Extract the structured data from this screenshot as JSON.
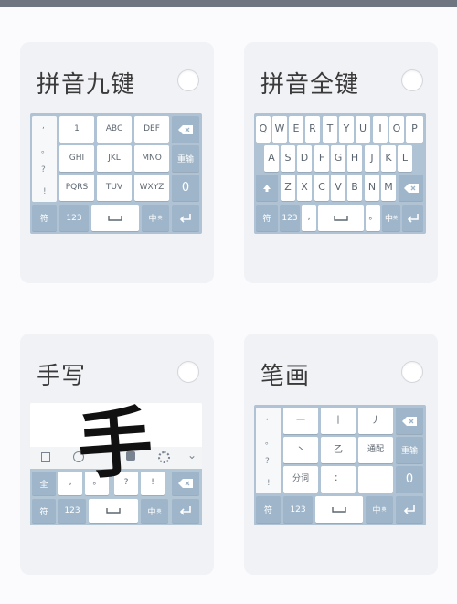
{
  "accent_color": "#afc3d4",
  "cards": {
    "pinyin9": {
      "title": "拼音九键",
      "keys": [
        "1",
        "ABC",
        "DEF",
        "GHI",
        "JKL",
        "MNO",
        "PQRS",
        "TUV",
        "WXYZ"
      ],
      "sym_strip": [
        ",",
        "。",
        "?",
        "!"
      ],
      "backspace_icon": "backspace-icon",
      "re_input": "重输",
      "zero": "0",
      "bottom": {
        "symbol": "符",
        "num": "123",
        "space_icon": "space-icon",
        "lang": "中",
        "lang_sub": "英",
        "enter_icon": "enter-icon"
      }
    },
    "pinyin26": {
      "title": "拼音全键",
      "row1": [
        "Q",
        "W",
        "E",
        "R",
        "T",
        "Y",
        "U",
        "I",
        "O",
        "P"
      ],
      "row2": [
        "A",
        "S",
        "D",
        "F",
        "G",
        "H",
        "J",
        "K",
        "L"
      ],
      "row3": [
        "Z",
        "X",
        "C",
        "V",
        "B",
        "N",
        "M"
      ],
      "shift_icon": "shift-icon",
      "backspace_icon": "backspace-icon",
      "bottom": {
        "symbol": "符",
        "num": "123",
        "comma": ",",
        "space_icon": "space-icon",
        "period": "。",
        "lang": "中",
        "lang_sub": "英",
        "enter_icon": "enter-icon"
      }
    },
    "handwrite": {
      "title": "手写",
      "sample_char": "手",
      "toolbar_icons": [
        "grid-icon",
        "emoji-icon",
        "handwrite-icon",
        "gear-icon",
        "chevron-down-icon"
      ],
      "quickbar": [
        "全",
        ",",
        "。",
        "?",
        "!"
      ],
      "backspace_icon": "backspace-icon",
      "bottom": {
        "symbol": "符",
        "num": "123",
        "space_icon": "space-icon",
        "lang": "中",
        "lang_sub": "英",
        "enter_icon": "enter-icon"
      }
    },
    "stroke": {
      "title": "笔画",
      "keys": [
        "一",
        "丨",
        "丿",
        "丶",
        "乙",
        "通配",
        "分词",
        "：",
        ""
      ],
      "sym_strip": [
        ",",
        "。",
        "?",
        "!"
      ],
      "backspace_icon": "backspace-icon",
      "re_input": "重输",
      "zero": "0",
      "bottom": {
        "symbol": "符",
        "num": "123",
        "space_icon": "space-icon",
        "lang": "中",
        "lang_sub": "英",
        "enter_icon": "enter-icon"
      }
    }
  }
}
